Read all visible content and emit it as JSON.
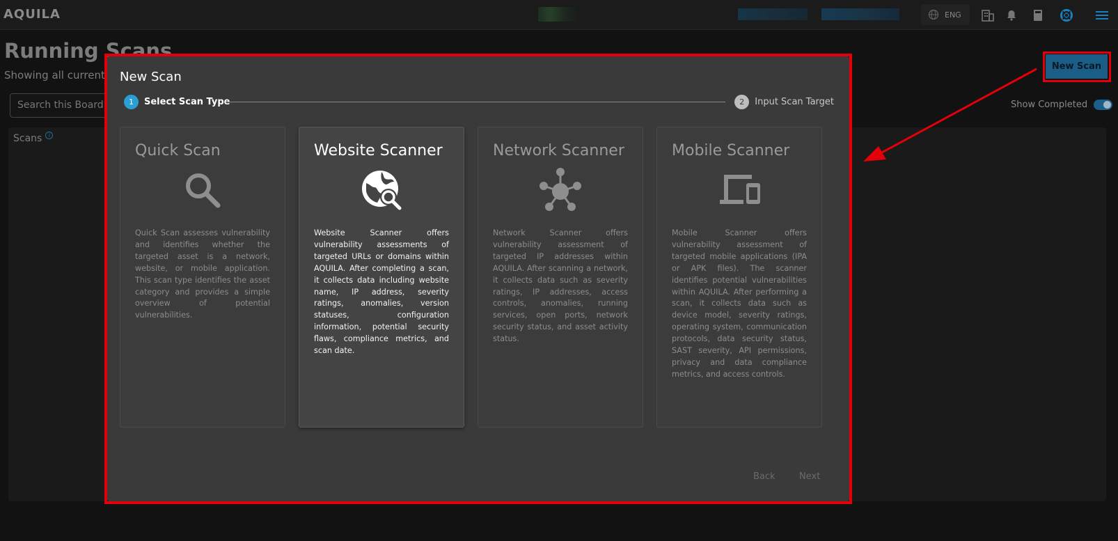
{
  "topbar": {
    "logo": "AQUILA",
    "language": "ENG",
    "icons": [
      "globe-icon",
      "building-icon",
      "bell-icon",
      "book-icon",
      "support-icon",
      "menu-icon"
    ]
  },
  "page": {
    "title": "Running Scans",
    "subtitle": "Showing all currentl",
    "search_placeholder": "Search this Board",
    "scans_label": "Scans",
    "show_completed": "Show Completed",
    "new_scan": "New Scan"
  },
  "modal": {
    "title": "New Scan",
    "steps": [
      {
        "num": "1",
        "label": "Select Scan Type"
      },
      {
        "num": "2",
        "label": "Input Scan Target"
      }
    ],
    "cards": [
      {
        "title": "Quick Scan",
        "icon": "magnifier-icon",
        "description": "Quick Scan assesses vulnerability and identifies whether the targeted asset is a network, website, or mobile application. This scan type identifies the asset category and provides a simple overview of potential vulnerabilities."
      },
      {
        "title": "Website Scanner",
        "icon": "globe-search-icon",
        "description": "Website Scanner offers vulnerability assessments of targeted URLs or domains within AQUILA. After completing a scan, it collects data including website name, IP address, severity ratings, anomalies, version statuses, configuration information, potential security flaws, compliance metrics, and scan date."
      },
      {
        "title": "Network Scanner",
        "icon": "network-hub-icon",
        "description": "Network Scanner offers vulnerability assessment of targeted IP addresses within AQUILA. After scanning a network, it collects data such as severity ratings, IP addresses, access controls, anomalies, running services, open ports, network security status, and asset activity status."
      },
      {
        "title": "Mobile Scanner",
        "icon": "devices-icon",
        "description": "Mobile Scanner offers vulnerability assessment of targeted mobile applications (IPA or APK files). The scanner identifies potential vulnerabilities within AQUILA. After performing a scan, it collects data such as device model, severity ratings, operating system, communication protocols, data security status, SAST severity, API permissions, privacy and data compliance metrics, and access controls."
      }
    ],
    "back": "Back",
    "next": "Next"
  },
  "colors": {
    "accent": "#2a9fd6",
    "highlight": "#e3000b",
    "modal_bg": "#3a3a3a"
  }
}
